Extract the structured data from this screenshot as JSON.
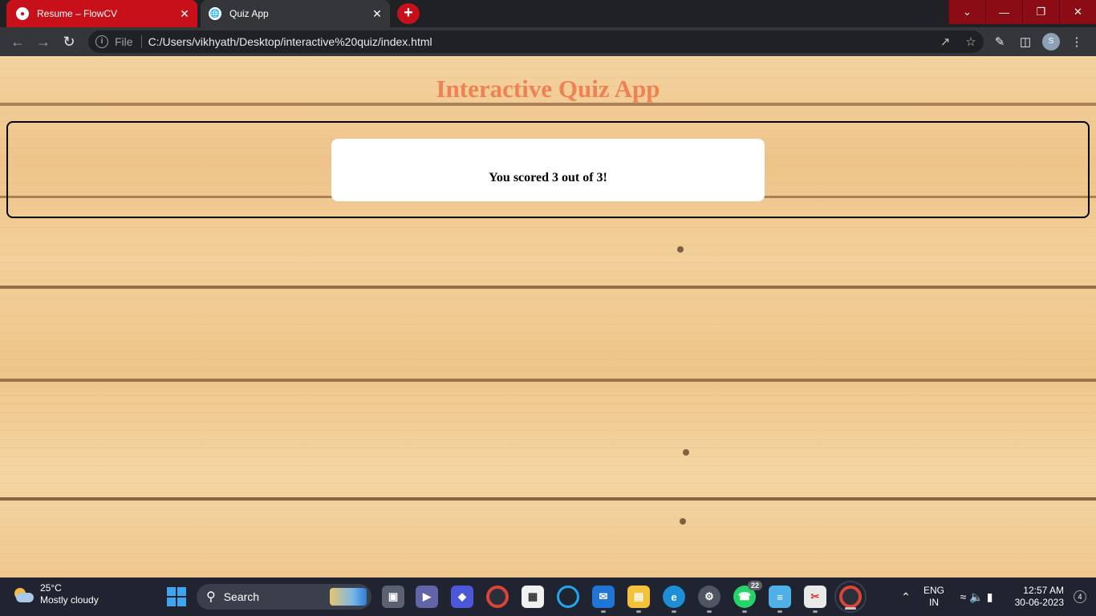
{
  "browser": {
    "tabs": [
      {
        "title": "Resume – FlowCV",
        "active": false
      },
      {
        "title": "Quiz App",
        "active": true
      }
    ],
    "new_tab_label": "+",
    "address": {
      "scheme_label": "File",
      "url": "C:/Users/vikhyath/Desktop/interactive%20quiz/index.html"
    },
    "profile_initial": "S",
    "accent_color": "#c8101b"
  },
  "page": {
    "title": "Interactive Quiz App",
    "title_color": "#f08154",
    "result_text": "You scored 3 out of 3!",
    "background": "wood-planks"
  },
  "taskbar": {
    "weather": {
      "temp": "25°C",
      "condition": "Mostly cloudy"
    },
    "search_label": "Search",
    "apps": [
      {
        "name": "task-view-icon"
      },
      {
        "name": "teams-icon"
      },
      {
        "name": "copilot-icon"
      },
      {
        "name": "chrome-icon"
      },
      {
        "name": "store-icon"
      },
      {
        "name": "cortana-icon"
      },
      {
        "name": "mail-icon"
      },
      {
        "name": "file-explorer-icon"
      },
      {
        "name": "edge-icon"
      },
      {
        "name": "settings-icon"
      },
      {
        "name": "whatsapp-icon",
        "badge": "22"
      },
      {
        "name": "notepad-icon"
      },
      {
        "name": "snipping-tool-icon"
      },
      {
        "name": "chrome-profile-icon"
      }
    ],
    "tray": {
      "language": "ENG",
      "region": "IN",
      "time": "12:57 AM",
      "date": "30-06-2023",
      "notifications": "4"
    }
  }
}
